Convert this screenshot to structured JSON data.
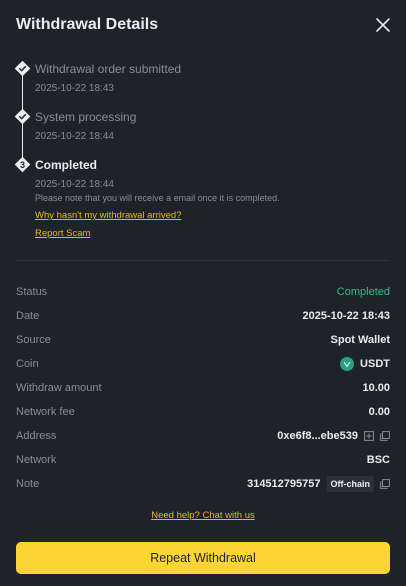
{
  "header": {
    "title": "Withdrawal Details"
  },
  "timeline": {
    "steps": [
      {
        "title": "Withdrawal order submitted",
        "time": "2025-10-22 18:43"
      },
      {
        "title": "System processing",
        "time": "2025-10-22 18:44"
      },
      {
        "title": "Completed",
        "time": "2025-10-22 18:44",
        "number": "3"
      }
    ],
    "note": "Please note that you will receive a email once it is completed.",
    "why_link": "Why hasn't my withdrawal arrived?",
    "report_link": "Report Scam"
  },
  "details": {
    "status_label": "Status",
    "status_value": "Completed",
    "date_label": "Date",
    "date_value": "2025-10-22 18:43",
    "source_label": "Source",
    "source_value": "Spot Wallet",
    "coin_label": "Coin",
    "coin_value": "USDT",
    "amount_label": "Withdraw amount",
    "amount_value": "10.00",
    "fee_label": "Network fee",
    "fee_value": "0.00",
    "address_label": "Address",
    "address_value": "0xe6f8...ebe539",
    "network_label": "Network",
    "network_value": "BSC",
    "note_label": "Note",
    "note_value": "314512795757",
    "note_badge": "Off-chain"
  },
  "footer": {
    "help_link": "Need help? Chat with us",
    "repeat_button": "Repeat Withdrawal"
  },
  "colors": {
    "background": "#1e2329",
    "accent": "#f0b90b",
    "button": "#fcd535",
    "success": "#2ebd85",
    "coin": "#26a17b"
  },
  "icons": {
    "close": "close-icon",
    "check": "check-icon",
    "coin": "usdt-icon",
    "address_detail": "qr-icon",
    "copy": "copy-icon"
  }
}
